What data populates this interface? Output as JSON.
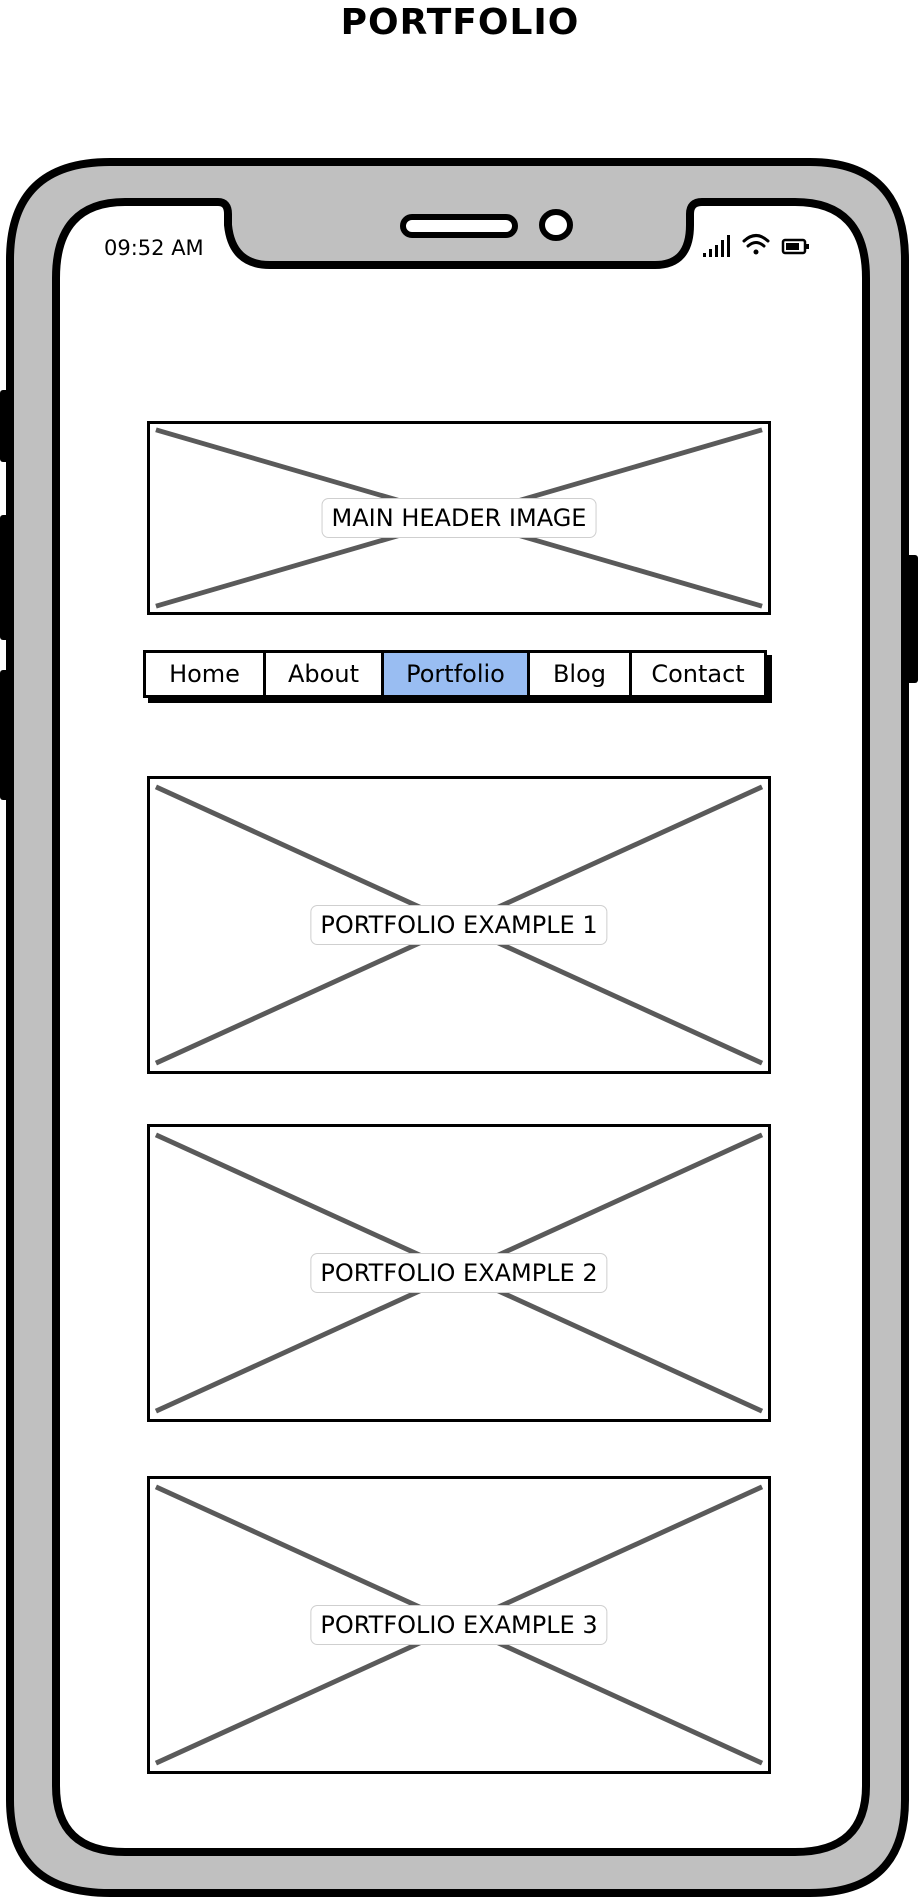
{
  "page": {
    "title": "PORTFOLIO"
  },
  "status_bar": {
    "time": "09:52 AM",
    "icons": [
      "signal-icon",
      "wifi-icon",
      "battery-icon"
    ]
  },
  "header_image": {
    "label": "MAIN HEADER IMAGE"
  },
  "nav": {
    "active_color": "#99bdf2",
    "items": [
      {
        "label": "Home",
        "active": false
      },
      {
        "label": "About",
        "active": false
      },
      {
        "label": "Portfolio",
        "active": true
      },
      {
        "label": "Blog",
        "active": false
      },
      {
        "label": "Contact",
        "active": false
      }
    ]
  },
  "portfolio": {
    "examples": [
      {
        "label": "PORTFOLIO EXAMPLE 1"
      },
      {
        "label": "PORTFOLIO EXAMPLE 2"
      },
      {
        "label": "PORTFOLIO EXAMPLE 3"
      }
    ]
  },
  "colors": {
    "phone_body": "#c0c0c0",
    "outline": "#000000",
    "placeholder_cross": "#5a5a5a"
  }
}
